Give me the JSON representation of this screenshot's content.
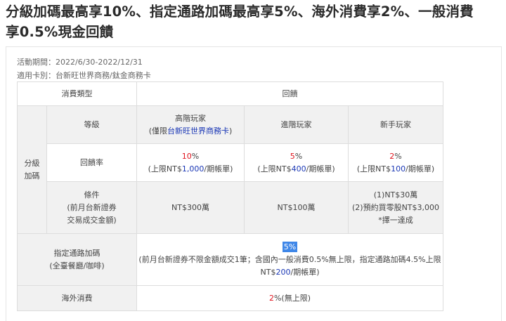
{
  "headline": {
    "line1": "分級加碼最高享10%、指定通路加碼最高享5%、海外消費享2%、一般消費",
    "line2": "享0.5%現金回饋"
  },
  "meta": {
    "period": "活動期間：2022/6/30-2022/12/31",
    "cards": "適用卡別：台新旺世界商務/鈦金商務卡"
  },
  "table": {
    "header": {
      "category": "消費類型",
      "reward": "回饋"
    },
    "tier_group": {
      "line1": "分級",
      "line2": "加碼"
    },
    "level_label": "等級",
    "tiers": [
      {
        "name": "高階玩家",
        "note_pre": "(僅限",
        "note_link": "台新旺世界商務卡",
        "note_post": ")"
      },
      {
        "name": "進階玩家"
      },
      {
        "name": "新手玩家"
      }
    ],
    "rate_label": "回饋率",
    "rates": [
      {
        "pct": "10",
        "cap_pre": "(上限NT$",
        "cap": "1,000",
        "cap_post": "/期帳單)"
      },
      {
        "pct": "5",
        "cap_pre": "(上限NT$",
        "cap": "400",
        "cap_post": "/期帳單)"
      },
      {
        "pct": "2",
        "cap_pre": "(上限NT$",
        "cap": "100",
        "cap_post": "/期帳單)"
      }
    ],
    "pct_sign": "%",
    "condition_label": {
      "line1": "條件",
      "line2": "(前月台新證券",
      "line3": "交易成交金額)"
    },
    "conditions": {
      "c0": "NT$300萬",
      "c1": "NT$100萬",
      "c2_line1": "(1)NT$30萬",
      "c2_line2": "(2)預約買零股NT$3,000",
      "c2_line3": "*擇一達成"
    },
    "channel": {
      "label_line1": "指定通路加碼",
      "label_line2": "(全臺餐廳/咖啡)",
      "rate": "5%",
      "desc_line1": "(前月台新證券不限金額成交1筆；含國內一般消費0.5%無上限，指定通路加碼4.5%上限",
      "desc_cap_pre": "NT$",
      "desc_cap": "200",
      "desc_cap_post": "/期帳單)"
    },
    "overseas": {
      "label": "海外消費",
      "pct": "2",
      "post": "%(無上限)"
    }
  }
}
